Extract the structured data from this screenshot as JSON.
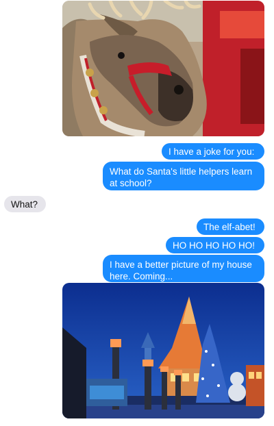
{
  "conversation": {
    "messages": [
      {
        "from": "me",
        "kind": "image",
        "image": "reindeer-photo"
      },
      {
        "from": "me",
        "kind": "text",
        "text": "I have a joke for you:"
      },
      {
        "from": "me",
        "kind": "text",
        "text": "What do Santa's little helpers learn at school?"
      },
      {
        "from": "them",
        "kind": "text",
        "text": "What?"
      },
      {
        "from": "me",
        "kind": "text",
        "text": "The elf-abet!"
      },
      {
        "from": "me",
        "kind": "text",
        "text": "HO HO HO HO HO!"
      },
      {
        "from": "me",
        "kind": "text",
        "text": "I have a better picture of my house here. Coming..."
      },
      {
        "from": "me",
        "kind": "image",
        "image": "santa-house-photo"
      }
    ]
  },
  "colors": {
    "outgoing_bubble": "#1a8cff",
    "incoming_bubble": "#e6e5eb",
    "background": "#ffffff"
  }
}
